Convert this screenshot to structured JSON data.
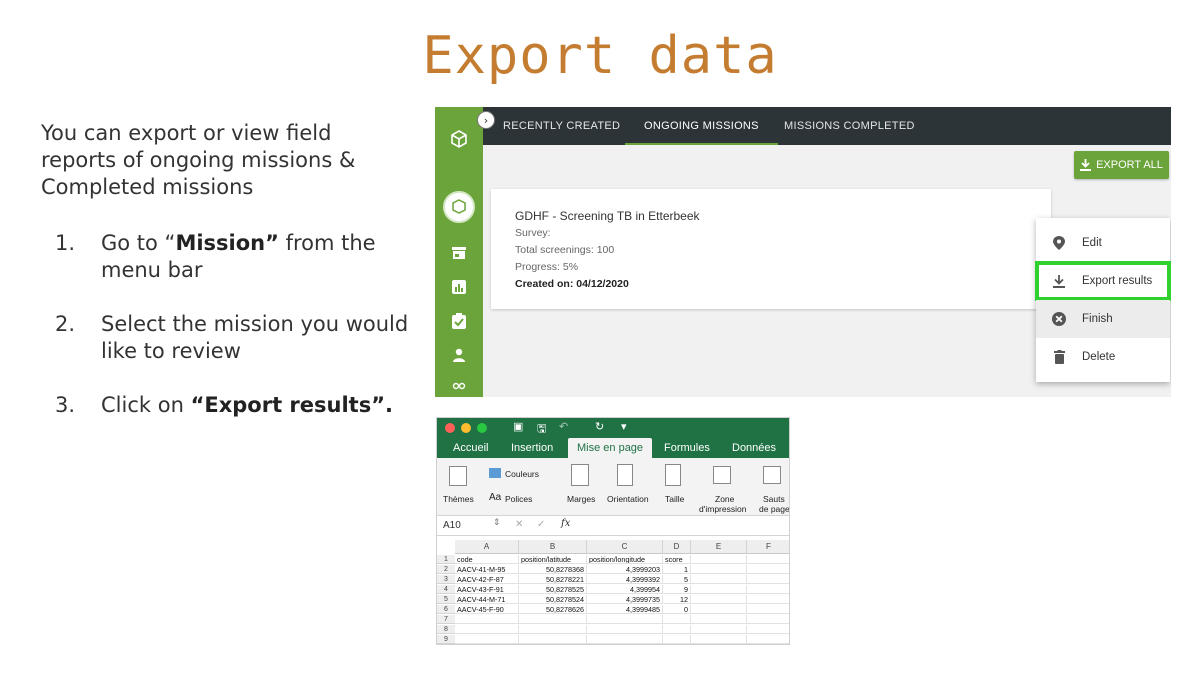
{
  "slide": {
    "title": "Export data",
    "intro": "You can export or view field reports of ongoing missions & Completed missions",
    "steps": [
      {
        "num": "1.",
        "pre": "Go to “",
        "bold": "Mission”",
        "post": " from the menu bar"
      },
      {
        "num": "2.",
        "pre": "Select the mission you would like to review",
        "bold": "",
        "post": ""
      },
      {
        "num": "3.",
        "pre": "Click on ",
        "bold": "“Export results”.",
        "post": ""
      }
    ]
  },
  "app": {
    "tabs": [
      "RECENTLY CREATED",
      "ONGOING MISSIONS",
      "MISSIONS COMPLETED"
    ],
    "active_tab": "ONGOING MISSIONS",
    "export_all_label": "EXPORT ALL",
    "mission": {
      "title": "GDHF - Screening TB in Etterbeek",
      "survey": "Survey:",
      "total": "Total screenings: 100",
      "progress": "Progress: 5%",
      "created": "Created on: 04/12/2020"
    },
    "menu": [
      {
        "label": "Edit",
        "icon": "pin-icon"
      },
      {
        "label": "Export results",
        "icon": "download-icon"
      },
      {
        "label": "Finish",
        "icon": "cancel-circle-icon"
      },
      {
        "label": "Delete",
        "icon": "trash-icon"
      }
    ],
    "sidebar_icons": [
      "cube-icon",
      "logo-badge",
      "store-icon",
      "chart-icon",
      "checklist-icon",
      "person-icon",
      "group-icon"
    ],
    "colors": {
      "green": "#6aa43a",
      "topbar": "#2c3438",
      "highlight": "#2ed12e"
    }
  },
  "excel": {
    "tabs": [
      "Accueil",
      "Insertion",
      "Mise en page",
      "Formules",
      "Données"
    ],
    "active_tab": "Mise en page",
    "ribbon": {
      "themes": "Thèmes",
      "couleurs": "Couleurs",
      "polices": "Polices",
      "marges": "Marges",
      "orientation": "Orientation",
      "taille": "Taille",
      "zone_1": "Zone",
      "zone_2": "d'impression",
      "sauts_1": "Sauts",
      "sauts_2": "de page"
    },
    "name_box": "A10",
    "fx": "fx",
    "columns": [
      "A",
      "B",
      "C",
      "D",
      "E",
      "F"
    ],
    "rows": [
      [
        "code",
        "position/latitude",
        "position/longitude",
        "score"
      ],
      [
        "AACV-41-M-95",
        "50,8278368",
        "4,3999203",
        "1"
      ],
      [
        "AACV-42-F-87",
        "50,8278221",
        "4,3999392",
        "5"
      ],
      [
        "AACV-43-F-91",
        "50,8278525",
        "4,399954",
        "9"
      ],
      [
        "AACV-44-M-71",
        "50,8278524",
        "4,3999735",
        "12"
      ],
      [
        "AACV-45-F-90",
        "50,8278626",
        "4,3999485",
        "0"
      ],
      [
        "",
        "",
        "",
        ""
      ],
      [
        "",
        "",
        "",
        ""
      ],
      [
        "",
        "",
        "",
        ""
      ]
    ]
  }
}
